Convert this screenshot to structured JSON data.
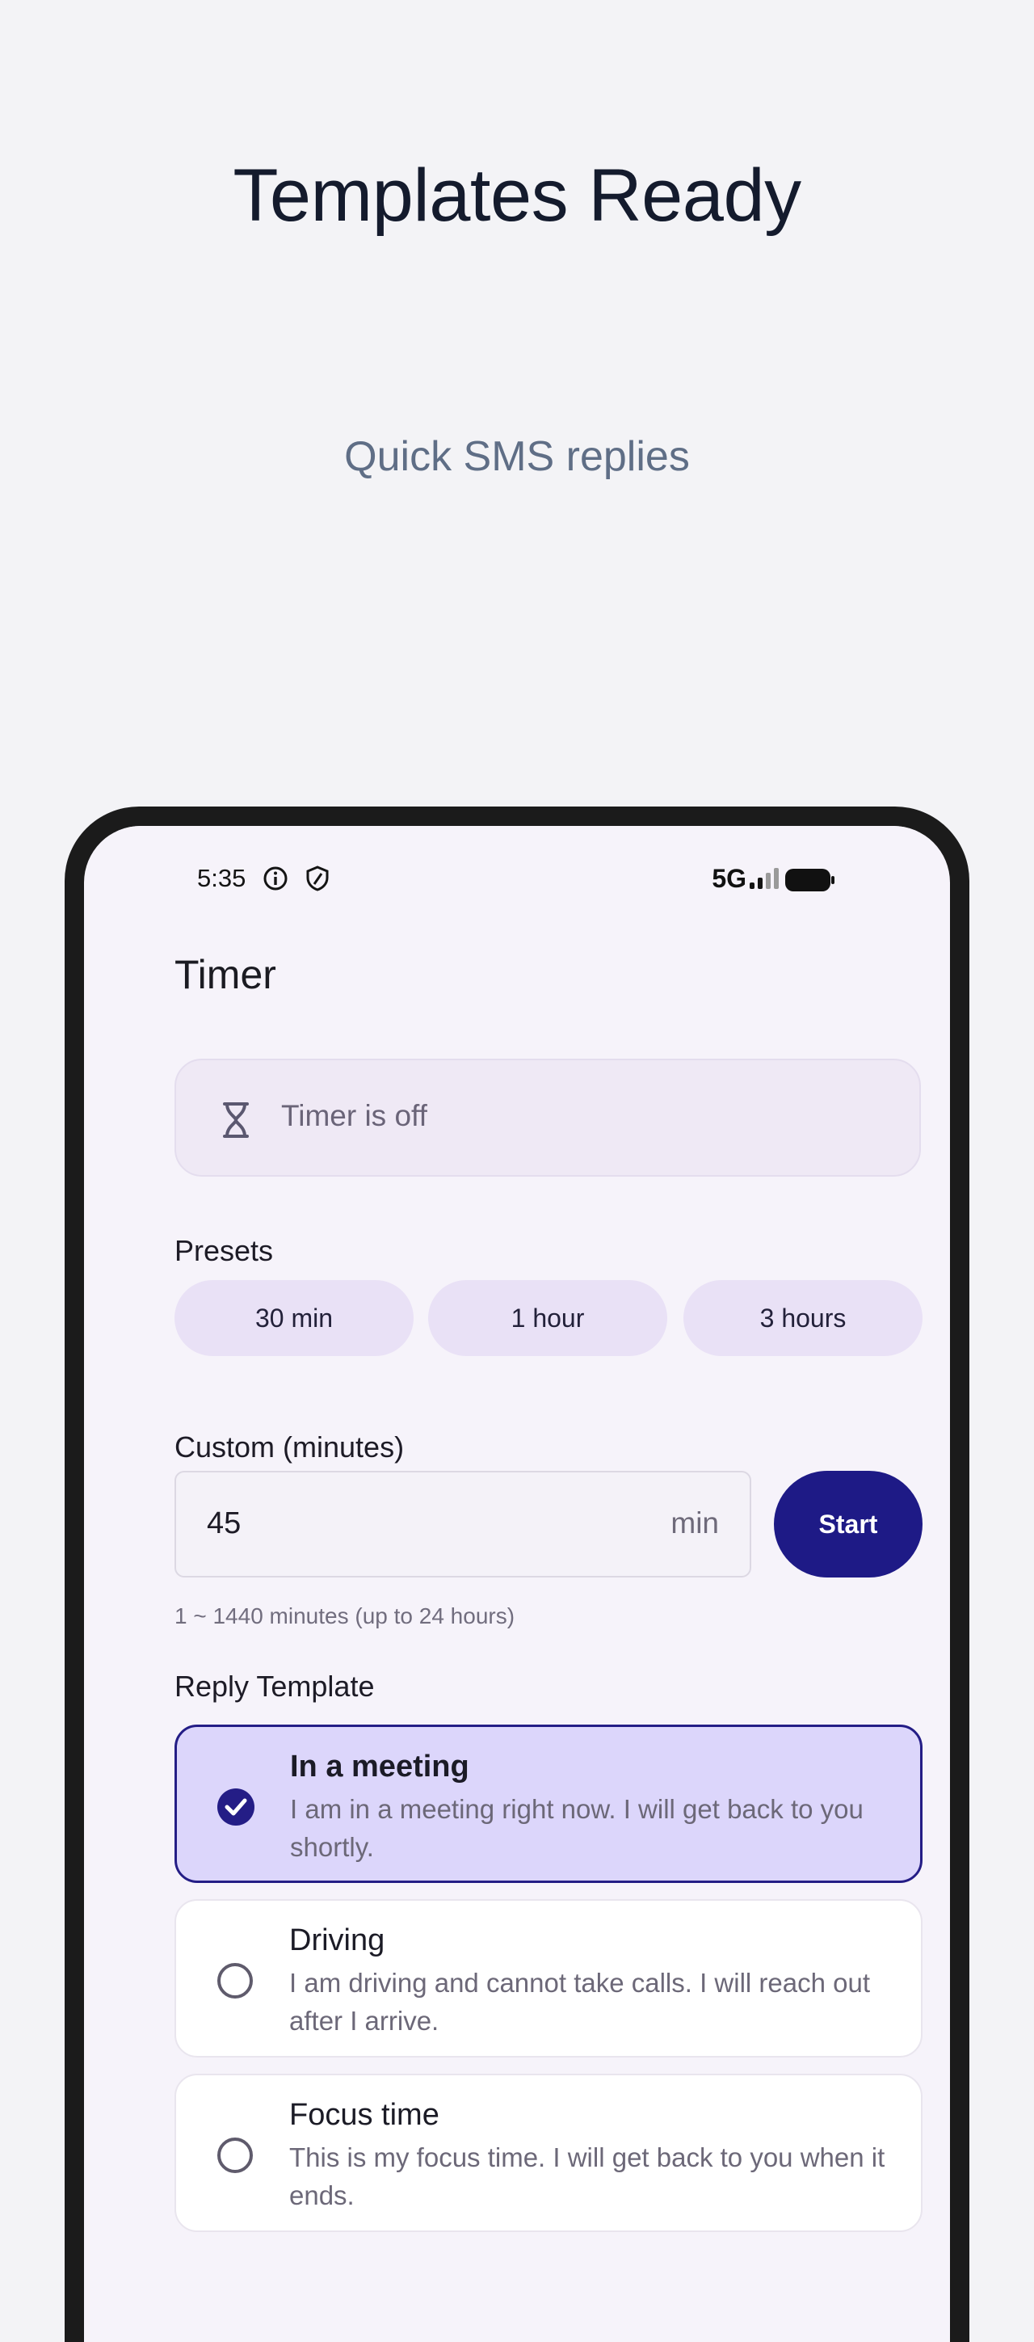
{
  "hero": {
    "title": "Templates Ready",
    "subtitle": "Quick SMS replies"
  },
  "status_bar": {
    "time": "5:35",
    "network": "5G",
    "left_icons": [
      "info-icon",
      "shield-icon"
    ],
    "right_icons": [
      "signal-icon",
      "battery-icon"
    ]
  },
  "screen": {
    "title": "Timer",
    "timer_status": "Timer is off",
    "presets_label": "Presets",
    "presets": [
      "30 min",
      "1 hour",
      "3 hours"
    ],
    "custom_label": "Custom (minutes)",
    "custom_value": "45",
    "custom_unit": "min",
    "start_label": "Start",
    "hint": "1 ~ 1440 minutes (up to 24 hours)",
    "templates_label": "Reply Template",
    "templates": [
      {
        "title": "In a meeting",
        "body": "I am in a meeting right now. I will get back to you shortly.",
        "selected": true
      },
      {
        "title": "Driving",
        "body": "I am driving and cannot take calls. I will reach out after I arrive.",
        "selected": false
      },
      {
        "title": "Focus time",
        "body": "This is my focus time. I will get back to you when it ends.",
        "selected": false
      }
    ]
  },
  "colors": {
    "accent": "#1e1a86",
    "selected_card": "#dcd6fb",
    "background": "#f3f3f6"
  }
}
